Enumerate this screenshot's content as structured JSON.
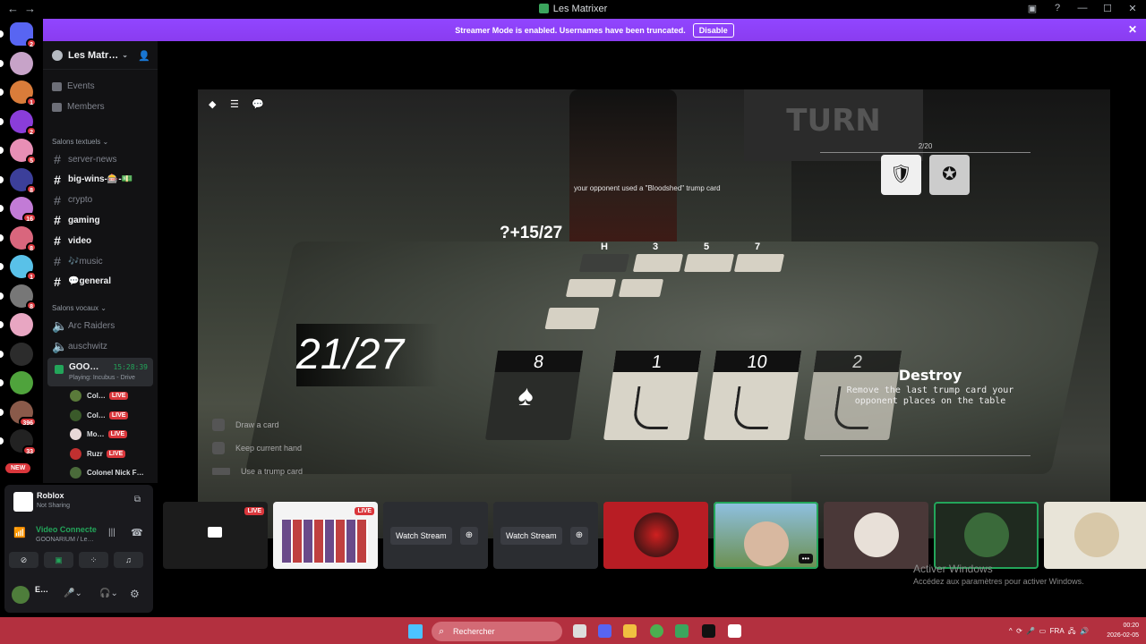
{
  "window": {
    "title": "Les Matrixer"
  },
  "banner": {
    "text": "Streamer Mode is enabled. Usernames have been truncated.",
    "button": "Disable"
  },
  "guilds": [
    {
      "badge": "2",
      "color": "#5865f2"
    },
    {
      "badge": "",
      "color": "#c7a3c8"
    },
    {
      "badge": "1",
      "color": "#d97c3a"
    },
    {
      "badge": "2",
      "color": "#8a3dd9"
    },
    {
      "badge": "5",
      "color": "#e88fb5"
    },
    {
      "badge": "8",
      "color": "#3c3f9a"
    },
    {
      "badge": "16",
      "color": "#c27bd6"
    },
    {
      "badge": "8",
      "color": "#d9667d"
    },
    {
      "badge": "1",
      "color": "#59c1e8"
    },
    {
      "badge": "8",
      "color": "#777777"
    },
    {
      "badge": "",
      "color": "#e8a6c2"
    },
    {
      "badge": "",
      "color": "#2c2c2c"
    },
    {
      "badge": "",
      "color": "#4fa33c"
    },
    {
      "badge": "396",
      "color": "#8a5a4a"
    },
    {
      "badge": "33",
      "color": "#222222"
    }
  ],
  "new_badge": "NEW",
  "server": {
    "name": "Les Matr…"
  },
  "nav": {
    "events": "Events",
    "members": "Members"
  },
  "categories": {
    "text": "Salons textuels",
    "voice": "Salons vocaux"
  },
  "text_channels": [
    {
      "name": "server-news",
      "bright": false
    },
    {
      "name": "big-wins-🎰-💵",
      "bright": true
    },
    {
      "name": "crypto",
      "bright": false
    },
    {
      "name": "gaming",
      "bright": true
    },
    {
      "name": "video",
      "bright": true
    },
    {
      "name": "🎶music",
      "bright": false
    },
    {
      "name": "💬general",
      "bright": true
    }
  ],
  "voice_channels": [
    "Arc Raiders",
    "auschwitz"
  ],
  "active_voice": {
    "name": "GOO…",
    "time": "15:28:39",
    "status": "Playing: Incubus - Drive"
  },
  "voice_users": [
    {
      "name": "Col…",
      "live": "LIVE"
    },
    {
      "name": "Col…",
      "live": "LIVE"
    },
    {
      "name": "Mo…",
      "live": "LIVE"
    },
    {
      "name": "Ruzr",
      "live": "LIVE"
    },
    {
      "name": "Colonel Nick F…",
      "live": ""
    }
  ],
  "activity": {
    "title": "Roblox",
    "subtitle": "Not Sharing"
  },
  "voice_conn": {
    "title": "Video Connecte",
    "subtitle": "GOONARIUM / Le…"
  },
  "user_panel": {
    "name": "E…"
  },
  "game": {
    "opponent_msg": "your opponent used a \"Bloodshed\" trump card",
    "opponent_score": "?+15/27",
    "opponent_cards": [
      "H",
      "3",
      "5",
      "7"
    ],
    "my_score": "21/27",
    "my_cards": [
      "8",
      "1",
      "10",
      "2"
    ],
    "trump_count": "2/20",
    "trump_title": "Destroy",
    "trump_desc": "Remove the last trump card your opponent places on the table",
    "hints": [
      "Draw a card",
      "Keep current hand",
      "Use a trump card"
    ],
    "turn_board": "TURN"
  },
  "streams": [
    {
      "type": "live",
      "label": "LIVE"
    },
    {
      "type": "live2",
      "label": "LIVE"
    },
    {
      "type": "watch",
      "label": "Watch Stream"
    },
    {
      "type": "watch",
      "label": "Watch Stream"
    },
    {
      "type": "avatar",
      "color": "#b81d24"
    },
    {
      "type": "video",
      "more": "•••"
    },
    {
      "type": "avatar",
      "color": "#4a3838"
    },
    {
      "type": "avatar",
      "color": "#1f2a1f"
    },
    {
      "type": "avatar",
      "color": "#e8e4d8"
    }
  ],
  "activation": {
    "title": "Activer Windows",
    "subtitle": "Accédez aux paramètres pour activer Windows."
  },
  "taskbar": {
    "search": "Rechercher",
    "lang": "FRA",
    "time": "00:20",
    "date": "2026-02-05"
  }
}
